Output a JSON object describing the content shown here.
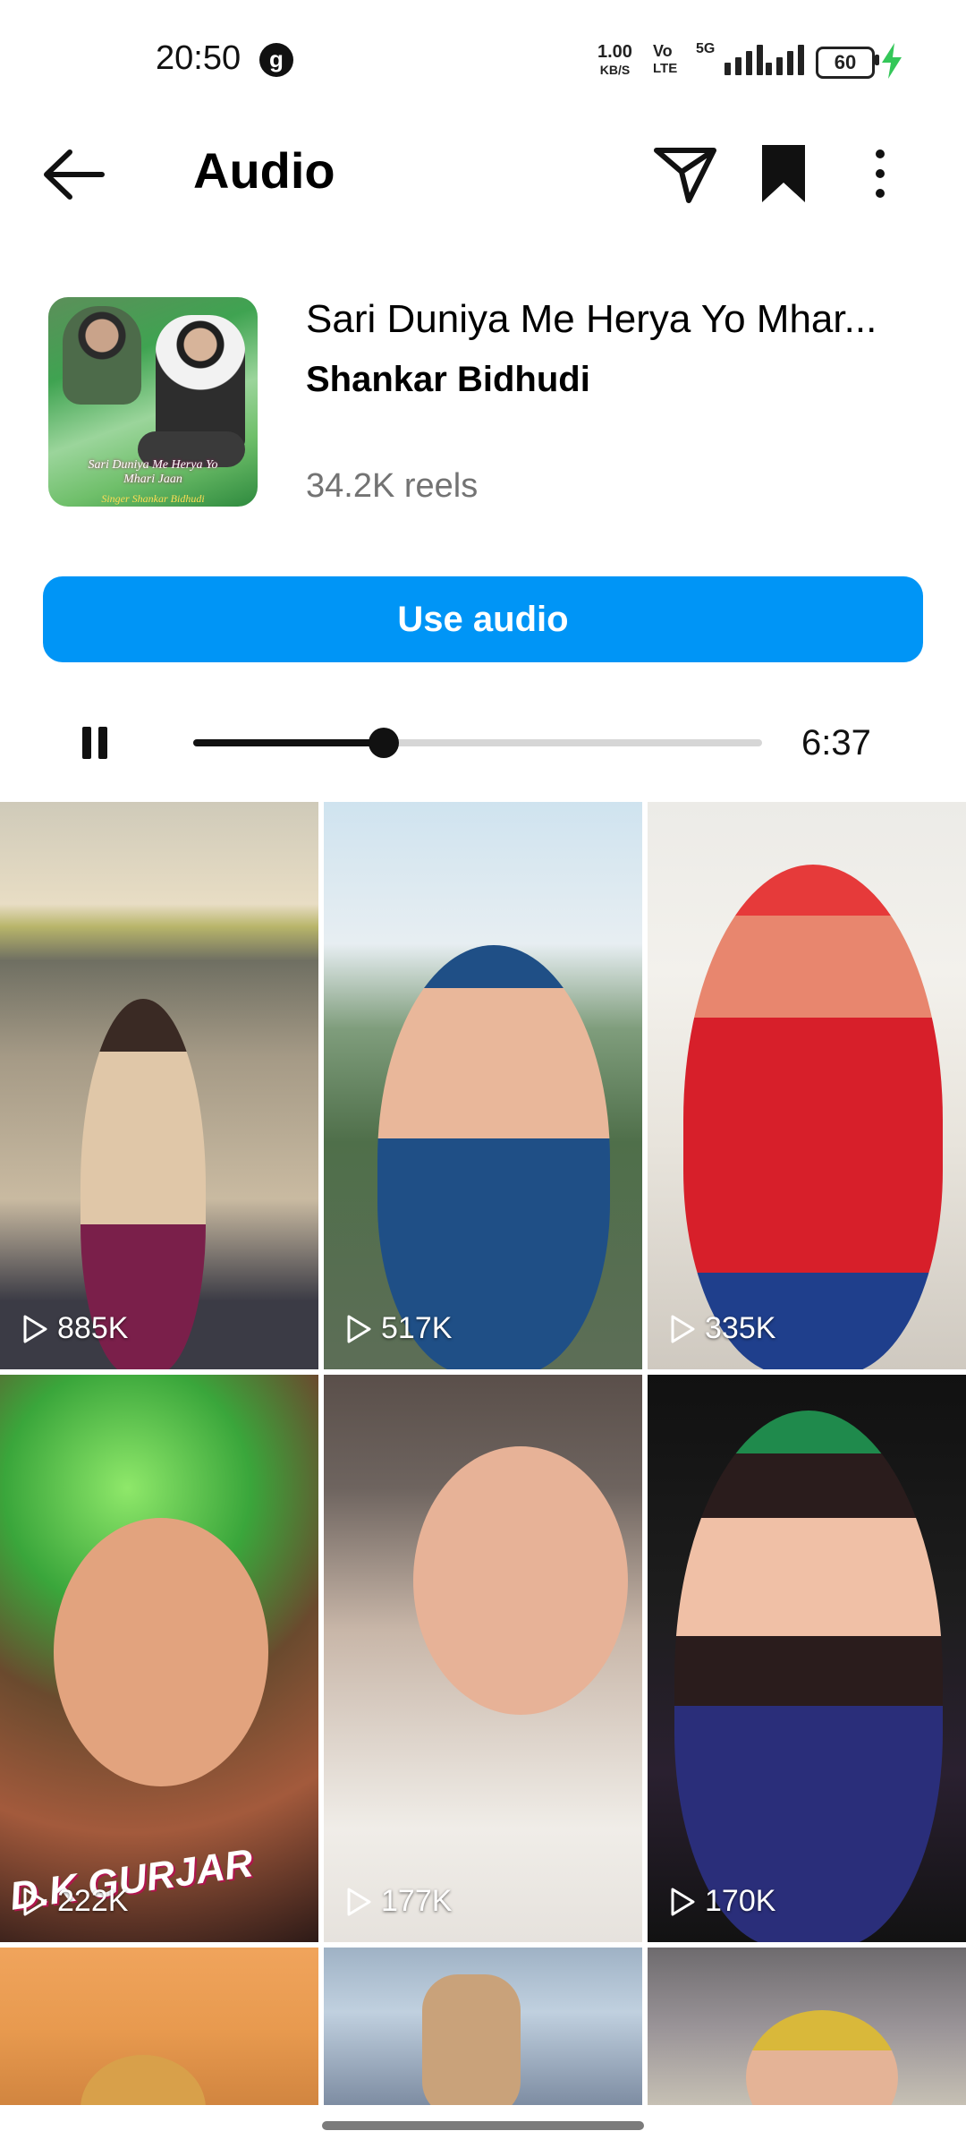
{
  "status_bar": {
    "time": "20:50",
    "badge_letter": "g",
    "net_speed_value": "1.00",
    "net_speed_unit": "KB/S",
    "volte_top": "Vo",
    "volte_bottom": "LTE",
    "network_type": "5G",
    "battery_level": "60"
  },
  "header": {
    "title": "Audio",
    "icons": [
      "back-arrow-icon",
      "send-icon",
      "bookmark-icon",
      "more-vertical-icon"
    ]
  },
  "audio": {
    "cover_caption_line1": "Sari Duniya Me Herya Yo",
    "cover_caption_line2": "Mhari Jaan",
    "cover_caption_line3": "Singer Shankar Bidhudi",
    "title": "Sari Duniya Me Herya Yo Mhar...",
    "artist": "Shankar Bidhudi",
    "reels_count": "34.2K reels",
    "use_button_label": "Use audio"
  },
  "player": {
    "state": "playing",
    "progress": 0.335,
    "duration": "6:37"
  },
  "reels": [
    {
      "views": "885K"
    },
    {
      "views": "517K"
    },
    {
      "views": "335K"
    },
    {
      "views": "222K",
      "overlay_text": "D.K GURJAR"
    },
    {
      "views": "177K"
    },
    {
      "views": "170K"
    },
    {
      "views": ""
    },
    {
      "views": ""
    },
    {
      "views": ""
    }
  ],
  "colors": {
    "accent": "#0095f6",
    "secondary_text": "#737373"
  }
}
